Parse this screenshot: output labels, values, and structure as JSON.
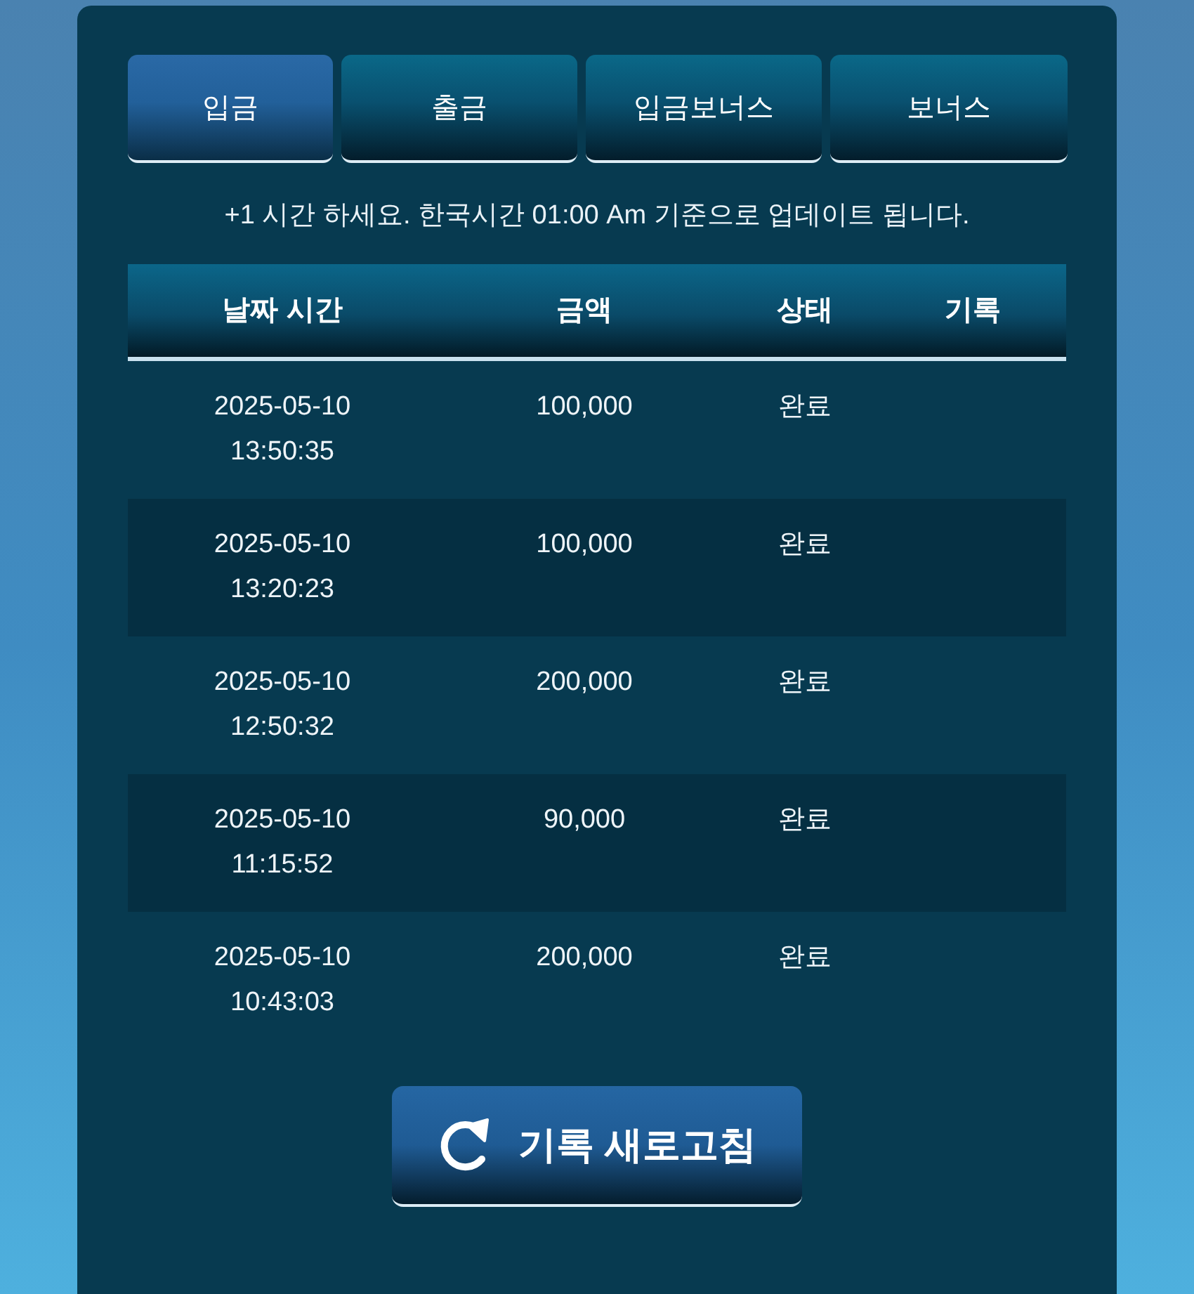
{
  "tabs": [
    {
      "label": "입금",
      "selected": true
    },
    {
      "label": "출금",
      "selected": false
    },
    {
      "label": "입금보너스",
      "selected": false
    },
    {
      "label": "보너스",
      "selected": false
    }
  ],
  "notice": "+1 시간 하세요. 한국시간 01:00 Am 기준으로 업데이트 됩니다.",
  "table": {
    "columns": [
      "날짜 시간",
      "금액",
      "상태",
      "기록"
    ],
    "rows": [
      {
        "date": "2025-05-10",
        "time": "13:50:35",
        "amount": "100,000",
        "status": "완료"
      },
      {
        "date": "2025-05-10",
        "time": "13:20:23",
        "amount": "100,000",
        "status": "완료"
      },
      {
        "date": "2025-05-10",
        "time": "12:50:32",
        "amount": "200,000",
        "status": "완료"
      },
      {
        "date": "2025-05-10",
        "time": "11:15:52",
        "amount": "90,000",
        "status": "완료"
      },
      {
        "date": "2025-05-10",
        "time": "10:43:03",
        "amount": "200,000",
        "status": "완료"
      }
    ]
  },
  "refresh_button": {
    "label": "기록 새로고침"
  }
}
